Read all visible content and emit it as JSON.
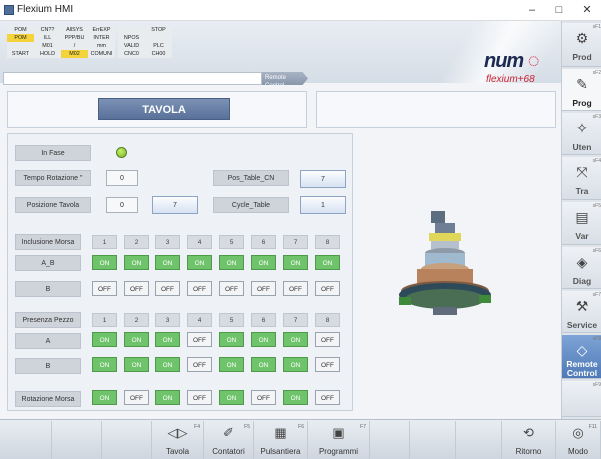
{
  "window": {
    "title": "Flexium HMI",
    "min": "–",
    "max": "□",
    "close": "✕"
  },
  "status": {
    "cells": [
      {
        "t": "POM",
        "c": "w"
      },
      {
        "t": "CN??",
        "c": "w"
      },
      {
        "t": "AllSYS",
        "c": "w"
      },
      {
        "t": "ErrEXP",
        "c": "w"
      },
      {
        "t": "",
        "c": "w"
      },
      {
        "t": "STOP",
        "c": "w"
      },
      {
        "t": "POM",
        "c": "y"
      },
      {
        "t": "ILL",
        "c": "w"
      },
      {
        "t": "PPP/BU",
        "c": "w"
      },
      {
        "t": "INTER",
        "c": "w"
      },
      {
        "t": "NPOS",
        "c": "w"
      },
      {
        "t": "",
        "c": "w"
      },
      {
        "t": "",
        "c": "w"
      },
      {
        "t": "M01",
        "c": "w"
      },
      {
        "t": "/",
        "c": "w"
      },
      {
        "t": "mm",
        "c": "w"
      },
      {
        "t": "VALID",
        "c": "w"
      },
      {
        "t": "PLC",
        "c": "w"
      },
      {
        "t": "START",
        "c": "w"
      },
      {
        "t": "HOLD",
        "c": "w"
      },
      {
        "t": "M02",
        "c": "y"
      },
      {
        "t": "COMUNI",
        "c": "w"
      },
      {
        "t": "CNC0",
        "c": "w"
      },
      {
        "t": "CH00",
        "c": "w"
      }
    ]
  },
  "brand": {
    "logo": "num",
    "flexium": "flexium+68"
  },
  "breadcrumb": {
    "label": "Remote Control"
  },
  "side": [
    {
      "label": "Prod",
      "fk": "sF1",
      "icon": "⚙",
      "name": "production-icon"
    },
    {
      "label": "Prog",
      "fk": "sF2",
      "icon": "✎",
      "name": "program-icon"
    },
    {
      "label": "Uten",
      "fk": "sF3",
      "icon": "✧",
      "name": "tools-icon"
    },
    {
      "label": "Tra",
      "fk": "sF4",
      "icon": "⤧",
      "name": "axis-icon"
    },
    {
      "label": "Var",
      "fk": "sF5",
      "icon": "▤",
      "name": "variables-icon"
    },
    {
      "label": "Diag",
      "fk": "sF6",
      "icon": "◈",
      "name": "diagnostics-icon"
    },
    {
      "label": "Service",
      "fk": "sF7",
      "icon": "⚒",
      "name": "service-icon"
    },
    {
      "label": "Remote Control",
      "fk": "sF8",
      "icon": "◇",
      "name": "remote-control-icon"
    },
    {
      "label": "",
      "fk": "sF9",
      "icon": "",
      "name": "empty-icon"
    }
  ],
  "main": {
    "title": "TAVOLA",
    "in_fase": "In Fase",
    "tempo_rot": "Tempo Rotazione \"",
    "tempo_val": "0",
    "pos_table_cn": "Pos_Table_CN",
    "pos_table_val": "7",
    "pos_tavola": "Posizione Tavola",
    "pos_tavola_val": "0",
    "pos_tavola_btn": "7",
    "cycle_table": "Cycle_Table",
    "cycle_val": "1",
    "incl_morsa": "Inclusione Morsa",
    "ab": "A_B",
    "b": "B",
    "presenza": "Presenza Pezzo",
    "a": "A",
    "b2": "B",
    "rot_morsa": "Rotazione Morsa",
    "nums": [
      "1",
      "2",
      "3",
      "4",
      "5",
      "6",
      "7",
      "8"
    ],
    "row_ab": [
      "ON",
      "ON",
      "ON",
      "ON",
      "ON",
      "ON",
      "ON",
      "ON"
    ],
    "row_b": [
      "OFF",
      "OFF",
      "OFF",
      "OFF",
      "OFF",
      "OFF",
      "OFF",
      "OFF"
    ],
    "row_a2": [
      "ON",
      "ON",
      "ON",
      "OFF",
      "ON",
      "ON",
      "ON",
      "OFF"
    ],
    "row_b2": [
      "ON",
      "ON",
      "ON",
      "OFF",
      "ON",
      "ON",
      "ON",
      "OFF"
    ],
    "row_rot": [
      "ON",
      "OFF",
      "ON",
      "OFF",
      "ON",
      "OFF",
      "ON",
      "OFF"
    ]
  },
  "fkeys": [
    {
      "label": "",
      "fk": "",
      "icon": ""
    },
    {
      "label": "",
      "fk": "",
      "icon": ""
    },
    {
      "label": "",
      "fk": "",
      "icon": ""
    },
    {
      "label": "Tavola",
      "fk": "F4",
      "icon": "◁▷"
    },
    {
      "label": "Contatori",
      "fk": "F5",
      "icon": "✐"
    },
    {
      "label": "Pulsantiera",
      "fk": "F6",
      "icon": "▦"
    },
    {
      "label": "Programmi",
      "fk": "F7",
      "icon": "▣"
    },
    {
      "label": "",
      "fk": "",
      "icon": ""
    },
    {
      "label": "",
      "fk": "",
      "icon": ""
    },
    {
      "label": "",
      "fk": "",
      "icon": ""
    },
    {
      "label": "Ritorno",
      "fk": "",
      "icon": "⟲"
    },
    {
      "label": "Modo",
      "fk": "F11",
      "icon": "◎"
    }
  ]
}
